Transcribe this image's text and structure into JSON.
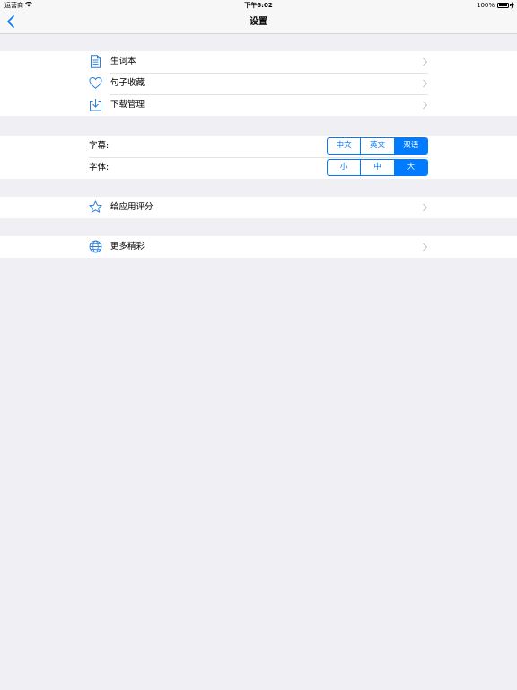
{
  "status_bar": {
    "carrier": "运营商",
    "time": "下午6:02",
    "battery": "100%"
  },
  "nav": {
    "title": "设置"
  },
  "section1": {
    "items": [
      {
        "label": "生词本",
        "icon": "document-icon"
      },
      {
        "label": "句子收藏",
        "icon": "heart-icon"
      },
      {
        "label": "下载管理",
        "icon": "download-icon"
      }
    ]
  },
  "section2": {
    "subtitle": {
      "label": "字幕:",
      "options": [
        "中文",
        "英文",
        "双语"
      ],
      "selected": "双语"
    },
    "font": {
      "label": "字体:",
      "options": [
        "小",
        "中",
        "大"
      ],
      "selected": "大"
    }
  },
  "section3": {
    "items": [
      {
        "label": "给应用评分",
        "icon": "star-icon"
      }
    ]
  },
  "section4": {
    "items": [
      {
        "label": "更多精彩",
        "icon": "globe-icon"
      }
    ]
  },
  "colors": {
    "accent": "#007aff",
    "background": "#efeff4"
  }
}
